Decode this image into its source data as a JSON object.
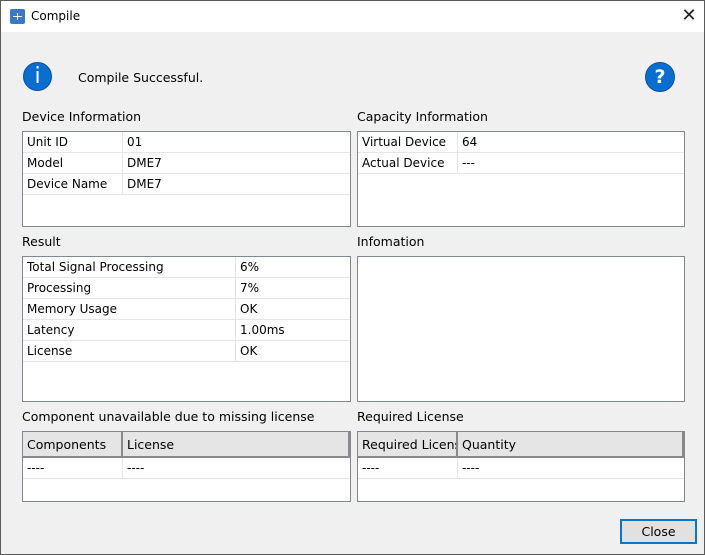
{
  "window": {
    "title": "Compile",
    "close_label": "✕"
  },
  "message": "Compile Successful.",
  "icons": {
    "info": "info-icon",
    "help": "help-icon"
  },
  "device_info": {
    "label": "Device Information",
    "rows": [
      [
        "Unit ID",
        "01"
      ],
      [
        "Model",
        "DME7"
      ],
      [
        "Device Name",
        "DME7"
      ]
    ]
  },
  "capacity_info": {
    "label": "Capacity Information",
    "rows": [
      [
        "Virtual Device",
        "64"
      ],
      [
        "Actual Device",
        "---"
      ]
    ]
  },
  "result": {
    "label": "Result",
    "rows": [
      [
        "Total Signal Processing",
        "6%"
      ],
      [
        "Processing",
        "7%"
      ],
      [
        "Memory Usage",
        "OK"
      ],
      [
        "Latency",
        "1.00ms"
      ],
      [
        "License",
        "OK"
      ]
    ]
  },
  "information": {
    "label": "Infomation"
  },
  "components": {
    "label": "Component unavailable due to missing license",
    "headers": [
      "Components",
      "License"
    ],
    "rows": [
      [
        "----",
        "----"
      ]
    ]
  },
  "required": {
    "label": "Required License",
    "headers": [
      "Required License",
      "Quantity"
    ],
    "rows": [
      [
        "----",
        "----"
      ]
    ]
  },
  "close_button": "Close"
}
